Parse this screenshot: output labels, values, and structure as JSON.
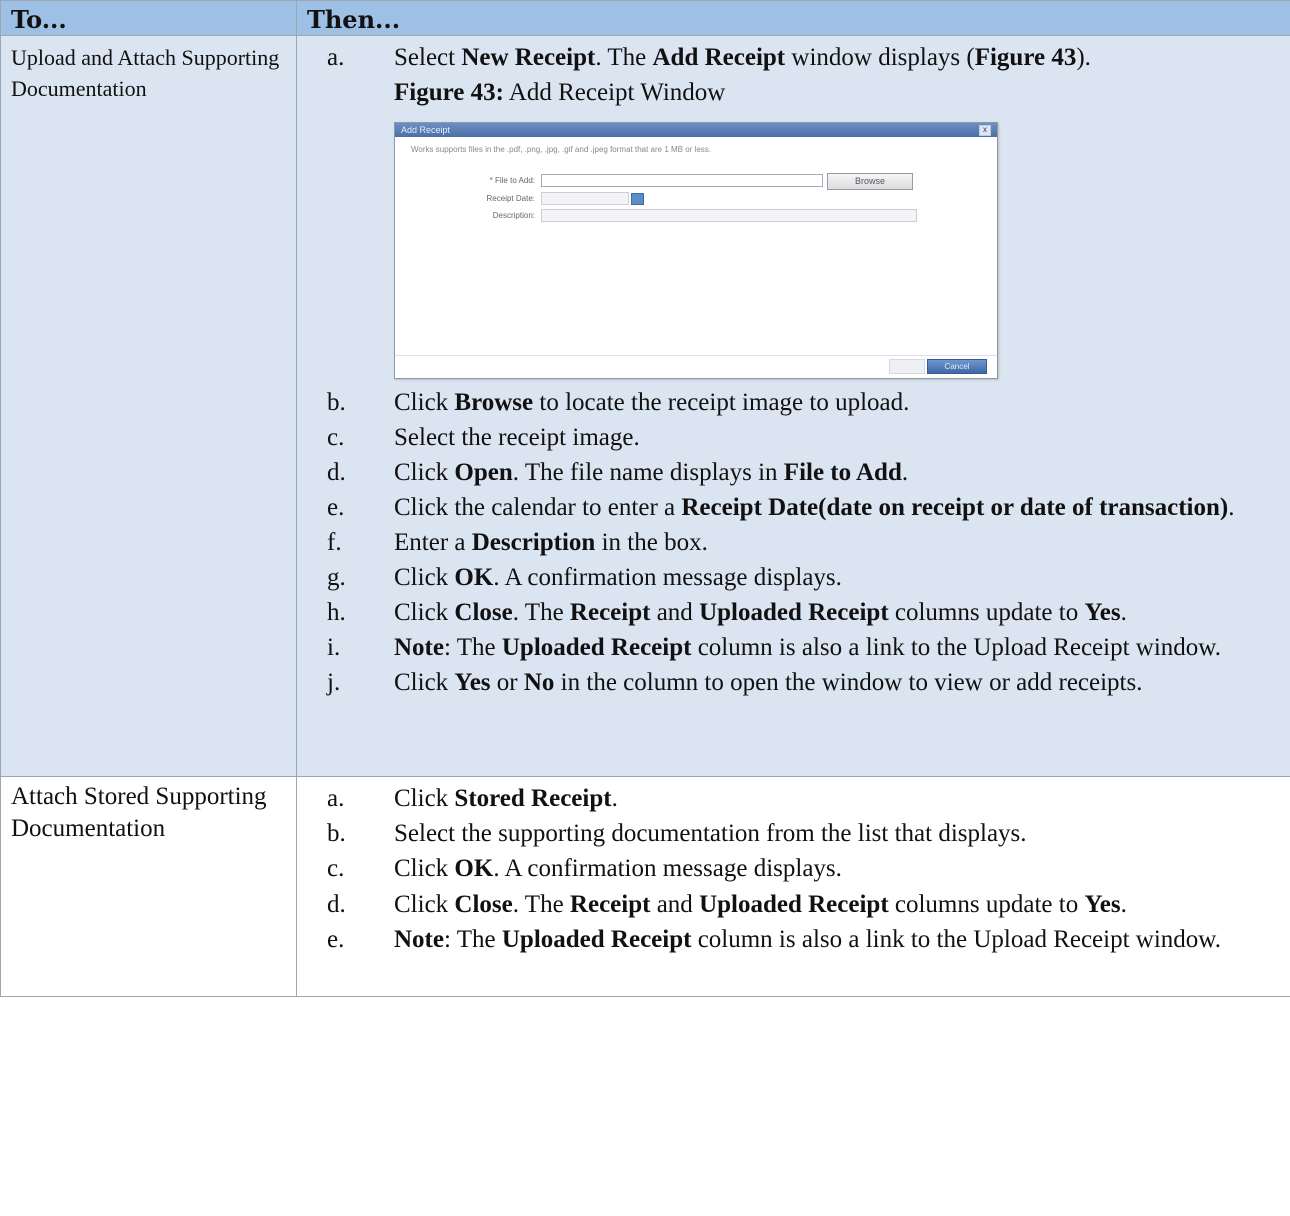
{
  "header": {
    "col_to": "To...",
    "col_then": "Then..."
  },
  "row1": {
    "to": "Upload and Attach Supporting Documentation",
    "steps": {
      "a": {
        "marker": "a.",
        "t1": "Select ",
        "b1": "New Receipt",
        "t2": ". The ",
        "b2": "Add Receipt",
        "t3": " window displays (",
        "b3": "Figure 43",
        "t4": ")."
      },
      "caption": {
        "b1": "Figure 43:",
        "t1": " Add Receipt Window"
      },
      "b": {
        "marker": "b.",
        "t1": "Click ",
        "b1": "Browse",
        "t2": " to locate the receipt image to upload."
      },
      "c": {
        "marker": "c.",
        "t1": "Select the receipt image."
      },
      "d": {
        "marker": "d.",
        "t1": "Click ",
        "b1": "Open",
        "t2": ". The file name displays in ",
        "b2": "File to Add",
        "t3": "."
      },
      "e": {
        "marker": "e.",
        "t1": "Click the calendar to enter a ",
        "b1": "Receipt  Date(date on receipt or date of transaction)",
        "t2": "."
      },
      "f": {
        "marker": "f.",
        "t1": "Enter a ",
        "b1": "Description",
        "t2": " in the box."
      },
      "g": {
        "marker": "g.",
        "t1": "Click ",
        "b1": "OK",
        "t2": ". A confirmation message displays."
      },
      "h": {
        "marker": "h.",
        "t1": "Click ",
        "b1": "Close",
        "t2": ". The ",
        "b2": "Receipt",
        "t3": " and ",
        "b3": "Uploaded Receipt",
        "t4": " columns update to ",
        "b4": "Yes",
        "t5": "."
      },
      "i": {
        "marker": "i.",
        "b1": "Note",
        "t1": ": The ",
        "b2": "Uploaded Receipt",
        "t2": " column is also a link to the Upload Receipt window."
      },
      "j": {
        "marker": "j.",
        "t1": "Click ",
        "b1": "Yes",
        "t2": " or ",
        "b2": "No",
        "t3": " in the column to open the window to view or add receipts."
      }
    }
  },
  "figure": {
    "title": "Add Receipt",
    "close": "x",
    "note": "Works supports files in the .pdf, .png, .jpg, .gif and .jpeg format that are 1 MB or less.",
    "file_label": "* File to Add:",
    "date_label": "Receipt Date:",
    "desc_label": "Description:",
    "browse": "Browse",
    "cancel": "Cancel"
  },
  "row2": {
    "to": "Attach Stored Supporting Documentation",
    "steps": {
      "a": {
        "marker": "a.",
        "t1": "Click ",
        "b1": "Stored Receipt",
        "t2": "."
      },
      "b": {
        "marker": "b.",
        "t1": "Select the supporting documentation from the list that displays."
      },
      "c": {
        "marker": "c.",
        "t1": "Click ",
        "b1": "OK",
        "t2": ". A confirmation message displays."
      },
      "d": {
        "marker": "d.",
        "t1": "Click ",
        "b1": "Close",
        "t2": ". The ",
        "b2": "Receipt",
        "t3": " and ",
        "b3": "Uploaded Receipt",
        "t4": " columns update to ",
        "b4": "Yes",
        "t5": "."
      },
      "e": {
        "marker": "e.",
        "b1": "Note",
        "t1": ": The ",
        "b2": "Uploaded Receipt",
        "t2": " column is also a link to the Upload Receipt window."
      }
    }
  }
}
